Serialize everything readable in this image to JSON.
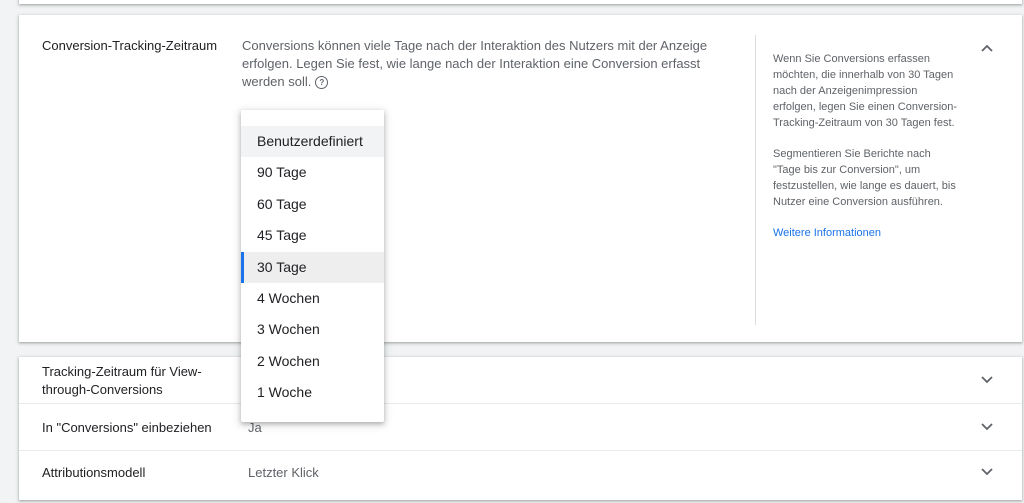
{
  "conversion_window": {
    "title": "Conversion-Tracking-Zeitraum",
    "description": "Conversions können viele Tage nach der Interaktion des Nutzers mit der Anzeige erfolgen. Legen Sie fest, wie lange nach der Interaktion eine Conversion erfasst werden soll.",
    "help_icon_glyph": "?",
    "sidebar": {
      "paragraph1": "Wenn Sie Conversions erfassen möchten, die innerhalb von 30 Tagen nach der Anzeigenimpression erfolgen, legen Sie einen Conversion-Tracking-Zeitraum von 30 Tagen fest.",
      "paragraph2": "Segmentieren Sie Berichte nach \"Tage bis zur Conversion\", um festzustellen, wie lange es dauert, bis Nutzer eine Conversion ausführen.",
      "link": "Weitere Informationen"
    },
    "dropdown_options": [
      "Benutzerdefiniert",
      "90 Tage",
      "60 Tage",
      "45 Tage",
      "30 Tage",
      "4 Wochen",
      "3 Wochen",
      "2 Wochen",
      "1 Woche"
    ],
    "selected_option": "30 Tage"
  },
  "rows": [
    {
      "title": "Tracking-Zeitraum für View-through-Conversions",
      "value": ""
    },
    {
      "title": "In \"Conversions\" einbeziehen",
      "value": "Ja"
    },
    {
      "title": "Attributionsmodell",
      "value": "Letzter Klick"
    }
  ],
  "colors": {
    "accent": "#1a73e8",
    "background": "#f1f3f4"
  }
}
